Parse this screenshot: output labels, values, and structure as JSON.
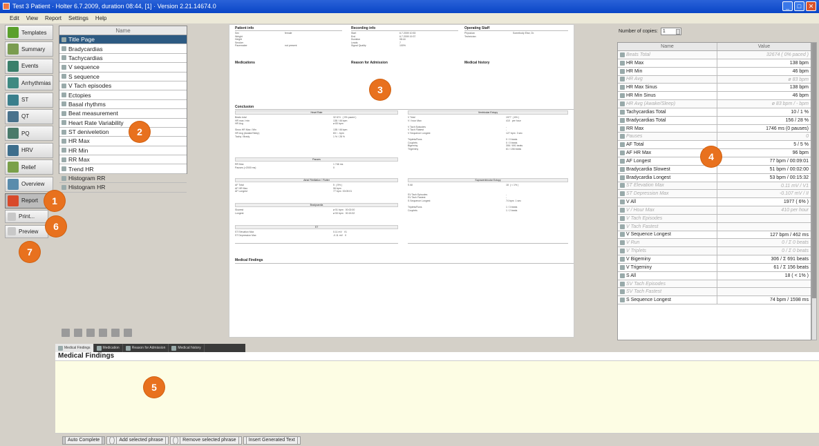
{
  "window": {
    "title": "Test 3 Patient · Holter 6.7.2009, duration 08:44, [1] · Version 2.21.14674.0"
  },
  "menu": [
    "Edit",
    "View",
    "Report",
    "Settings",
    "Help"
  ],
  "nav": {
    "items": [
      {
        "label": "Templates",
        "icon": "templates-icon",
        "color": "#5aa02c"
      },
      {
        "label": "Summary",
        "icon": "summary-icon",
        "color": "#7a9c50"
      },
      {
        "label": "Events",
        "icon": "events-icon",
        "color": "#3a7f6a"
      },
      {
        "label": "Arrhythmias",
        "icon": "arrhythmias-icon",
        "color": "#3f8a82"
      },
      {
        "label": "ST",
        "icon": "st-icon",
        "color": "#3a7f8c"
      },
      {
        "label": "QT",
        "icon": "qt-icon",
        "color": "#49728c"
      },
      {
        "label": "PQ",
        "icon": "pq-icon",
        "color": "#4a7a6a"
      },
      {
        "label": "HRV",
        "icon": "hrv-icon",
        "color": "#3d6e8c"
      },
      {
        "label": "Relief",
        "icon": "relief-icon",
        "color": "#7aa04a"
      },
      {
        "label": "Overview",
        "icon": "overview-icon",
        "color": "#5a8cac"
      },
      {
        "label": "Report",
        "icon": "report-icon",
        "color": "#d84a2a"
      }
    ],
    "print_label": "Print...",
    "preview_label": "Preview"
  },
  "sections": {
    "header": "Name",
    "items": [
      "Title Page",
      "Bradycardias",
      "Tachycardias",
      "V sequence",
      "S sequence",
      "V Tach episodes",
      "Ectopies",
      "Basal rhythms",
      "Beat measurement",
      "Heart Rate Variability",
      "ST deniveletion",
      "HR Max",
      "HR Min",
      "RR Max",
      "Trend HR",
      "Histogram RR",
      "Histogram HR"
    ]
  },
  "document": {
    "patient_info": "Patient info",
    "recording_info": "Recording info",
    "operating_staff": "Operating Staff",
    "medications": "Medications",
    "reason": "Reason for Admission",
    "history": "Medical history",
    "conclusion": "Conclusion",
    "findings": "Medical Findings"
  },
  "copies": {
    "label": "Number of copies:",
    "value": "1"
  },
  "values_table": {
    "col_name": "Name",
    "col_value": "Value",
    "rows": [
      {
        "name": "Beats Total",
        "value": "32674 ( 0% paced )",
        "disabled": true
      },
      {
        "name": "HR Max",
        "value": "138 bpm",
        "disabled": false
      },
      {
        "name": "HR Min",
        "value": "46 bpm",
        "disabled": false
      },
      {
        "name": "HR Avg",
        "value": "ø 83 bpm",
        "disabled": true
      },
      {
        "name": "HR Max Sinus",
        "value": "138 bpm",
        "disabled": false
      },
      {
        "name": "HR Min Sinus",
        "value": "46 bpm",
        "disabled": false
      },
      {
        "name": "HR Avg (Awake/Sleep)",
        "value": "ø 83 bpm / - bpm",
        "disabled": true
      },
      {
        "name": "Tachycardias Total",
        "value": "10 / 1 %",
        "disabled": false
      },
      {
        "name": "Bradycardias Total",
        "value": "156 / 28 %",
        "disabled": false
      },
      {
        "name": "RR Max",
        "value": "1746 ms (0 pauses)",
        "disabled": false
      },
      {
        "name": "Pauses",
        "value": "0",
        "disabled": true
      },
      {
        "name": "AF Total",
        "value": "5 / 5 %",
        "disabled": false
      },
      {
        "name": "AF HR Max",
        "value": "96 bpm",
        "disabled": false
      },
      {
        "name": "AF Longest",
        "value": "77 bpm / 00:09:01",
        "disabled": false
      },
      {
        "name": "Bradycardia Slowest",
        "value": "51 bpm / 00:02:00",
        "disabled": false
      },
      {
        "name": "Bradycardia Longest",
        "value": "53 bpm / 00:15:32",
        "disabled": false
      },
      {
        "name": "ST Elevation Max",
        "value": "0.11 mV / V1",
        "disabled": true
      },
      {
        "name": "ST Depression Max",
        "value": "-0.107 mV / II",
        "disabled": true
      },
      {
        "name": "V All",
        "value": "1977 ( 6% )",
        "disabled": false
      },
      {
        "name": "V / Hour Max",
        "value": "410 per hour",
        "disabled": true
      },
      {
        "name": "V Tach Episodes",
        "value": "",
        "disabled": true
      },
      {
        "name": "V Tach Fastest",
        "value": "",
        "disabled": true
      },
      {
        "name": "V Sequence Longest",
        "value": "127 bpm / 462 ms",
        "disabled": false
      },
      {
        "name": "V Run",
        "value": "0 / Σ 0 beats",
        "disabled": true
      },
      {
        "name": "V Triplets",
        "value": "0 / Σ 0 beats",
        "disabled": true
      },
      {
        "name": "V Bigeminy",
        "value": "306 / Σ 691 beats",
        "disabled": false
      },
      {
        "name": "V Trigeminy",
        "value": "61 / Σ 156 beats",
        "disabled": false
      },
      {
        "name": "S All",
        "value": "18 ( < 1% )",
        "disabled": false
      },
      {
        "name": "SV Tach Episodes",
        "value": "",
        "disabled": true
      },
      {
        "name": "SV Tach Fastest",
        "value": "",
        "disabled": true
      },
      {
        "name": "S Sequence Longest",
        "value": "74 bpm / 1598 ms",
        "disabled": false
      }
    ]
  },
  "bottom": {
    "tabs": [
      "Medical Findings",
      "Medication",
      "Reason for Admission",
      "Medical history"
    ],
    "title": "Medical Findings",
    "buttons": [
      "Auto Complete",
      "Add selected phrase",
      "Remove selected phrase",
      "Insert Generated Text"
    ]
  },
  "badges": [
    "1",
    "2",
    "3",
    "4",
    "5",
    "6",
    "7"
  ]
}
